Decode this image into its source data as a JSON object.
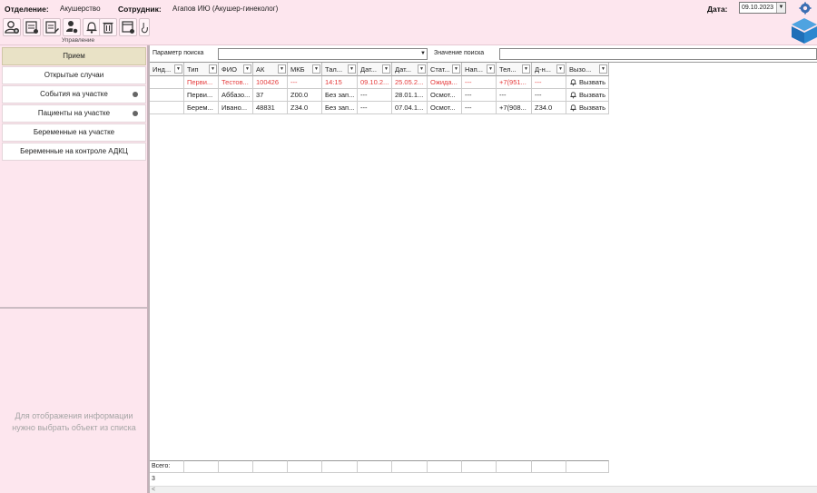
{
  "header": {
    "department_label": "Отделение:",
    "department_value": "Акушерство",
    "employee_label": "Сотрудник:",
    "employee_value": "Агапов ИЮ (Акушер-гинеколог)",
    "date_label": "Дата:",
    "date_value": "09.10.2023",
    "toolbar_caption": "Управление",
    "toolbar_icons": [
      "user-add-icon",
      "clipboard-list-icon",
      "edit-document-icon",
      "users-settings-icon",
      "bell-icon",
      "trash-icon",
      "window-settings-icon",
      "hand-pointer-icon"
    ]
  },
  "sidebar": {
    "items": [
      {
        "label": "Прием",
        "active": true,
        "dot": false
      },
      {
        "label": "Открытые случаи",
        "active": false,
        "dot": false
      },
      {
        "label": "События на участке",
        "active": false,
        "dot": true
      },
      {
        "label": "Пациенты на участке",
        "active": false,
        "dot": true
      },
      {
        "label": "Беременные на участке",
        "active": false,
        "dot": false
      },
      {
        "label": "Беременные на контроле АДКЦ",
        "active": false,
        "dot": false
      }
    ],
    "empty_message_line1": "Для отображения информации",
    "empty_message_line2": "нужно выбрать объект из списка"
  },
  "search": {
    "param_label": "Параметр поиска",
    "param_value": "",
    "value_label": "Значение поиска",
    "value_value": ""
  },
  "grid": {
    "columns": [
      "Инд...",
      "Тип",
      "ФИО",
      "АК",
      "МКБ",
      "Тал...",
      "Дат...",
      "Дат...",
      "Стат...",
      "Нап...",
      "Тел...",
      "Д-н...",
      "Вызо..."
    ],
    "rows": [
      {
        "highlight": true,
        "cells": [
          "",
          "Перви...",
          "Тестов...",
          "100426",
          "---",
          "14:15",
          "09.10.2...",
          "25.05.2...",
          "Ожида...",
          "---",
          "+7(951...",
          "---"
        ],
        "call": "Вызвать"
      },
      {
        "highlight": false,
        "cells": [
          "",
          "Перви...",
          "Аббазо...",
          "37",
          "Z00.0",
          "Без зап...",
          "---",
          "28.01.1...",
          "Осмот...",
          "---",
          "---",
          "---"
        ],
        "call": "Вызвать"
      },
      {
        "highlight": false,
        "cells": [
          "",
          "Берем...",
          "Ивано...",
          "48831",
          "Z34.0",
          "Без зап...",
          "---",
          "07.04.1...",
          "Осмот...",
          "---",
          "+7(908...",
          "Z34.0"
        ],
        "call": "Вызвать"
      }
    ],
    "total_label": "Всего:",
    "total_value": "3"
  }
}
